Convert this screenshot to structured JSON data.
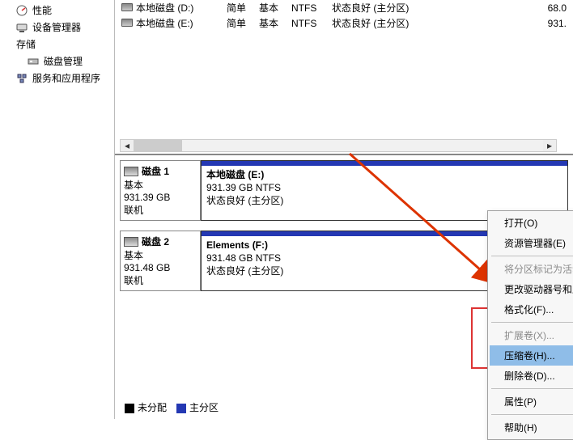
{
  "sidebar": {
    "items": [
      {
        "label": "性能",
        "icon": "perf-icon"
      },
      {
        "label": "设备管理器",
        "icon": "device-mgr-icon"
      },
      {
        "label": "存储",
        "icon": "storage-icon"
      },
      {
        "label": "磁盘管理",
        "icon": "disk-mgmt-icon"
      },
      {
        "label": "服务和应用程序",
        "icon": "services-icon"
      }
    ]
  },
  "volumes": [
    {
      "name": "本地磁盘 (D:)",
      "layout": "简单",
      "type": "基本",
      "fs": "NTFS",
      "status": "状态良好 (主分区)",
      "size": "68.0"
    },
    {
      "name": "本地磁盘 (E:)",
      "layout": "简单",
      "type": "基本",
      "fs": "NTFS",
      "status": "状态良好 (主分区)",
      "size": "931."
    }
  ],
  "disks": [
    {
      "title": "磁盘 1",
      "kind": "基本",
      "size": "931.39 GB",
      "state": "联机",
      "partition": {
        "label": "本地磁盘   (E:)",
        "size": "931.39 GB NTFS",
        "status": "状态良好 (主分区)"
      }
    },
    {
      "title": "磁盘 2",
      "kind": "基本",
      "size": "931.48 GB",
      "state": "联机",
      "partition": {
        "label": "Elements   (F:)",
        "size": "931.48 GB NTFS",
        "status": "状态良好 (主分区)"
      }
    }
  ],
  "legend": {
    "unallocated": "未分配",
    "primary": "主分区"
  },
  "menu": {
    "open": "打开(O)",
    "explorer": "资源管理器(E)",
    "mark_active": "将分区标记为活动分区(M)",
    "change_letter": "更改驱动器号和路径(C)...",
    "format": "格式化(F)...",
    "extend": "扩展卷(X)...",
    "shrink": "压缩卷(H)...",
    "delete": "删除卷(D)...",
    "properties": "属性(P)",
    "help": "帮助(H)"
  }
}
